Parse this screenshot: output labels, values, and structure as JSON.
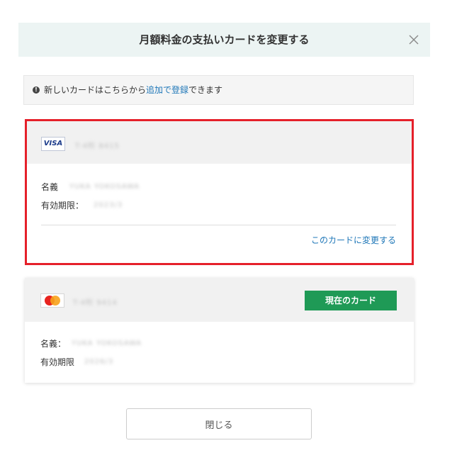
{
  "modal": {
    "title": "月額料金の支払いカードを変更する",
    "close_icon": "close-icon"
  },
  "notice": {
    "icon": "info-icon",
    "icon_glyph": "!",
    "text_before": "新しいカードはこちらから",
    "link_text": "追加で登録",
    "text_after": "できます"
  },
  "cards": [
    {
      "brand": "VISA",
      "number_masked": "T-4桁 8415",
      "holder_label": "名義",
      "holder_value": "YUKA YOKOSAWA",
      "expiry_label": "有効期限：",
      "expiry_value": "2023/3",
      "action_label": "このカードに変更する",
      "selected": true
    },
    {
      "brand": "MasterCard",
      "number_masked": "T-4桁 9414",
      "holder_label": "名義：",
      "holder_value": "YUKA YOKOSAWA",
      "expiry_label": "有効期限",
      "expiry_value": "2026/3",
      "badge_label": "現在のカード",
      "current": true
    }
  ],
  "footer": {
    "close_button_label": "閉じる"
  },
  "colors": {
    "header_bg": "#ecf4f3",
    "selected_border": "#e5202a",
    "link": "#1f77b8",
    "badge": "#1f9a56"
  }
}
